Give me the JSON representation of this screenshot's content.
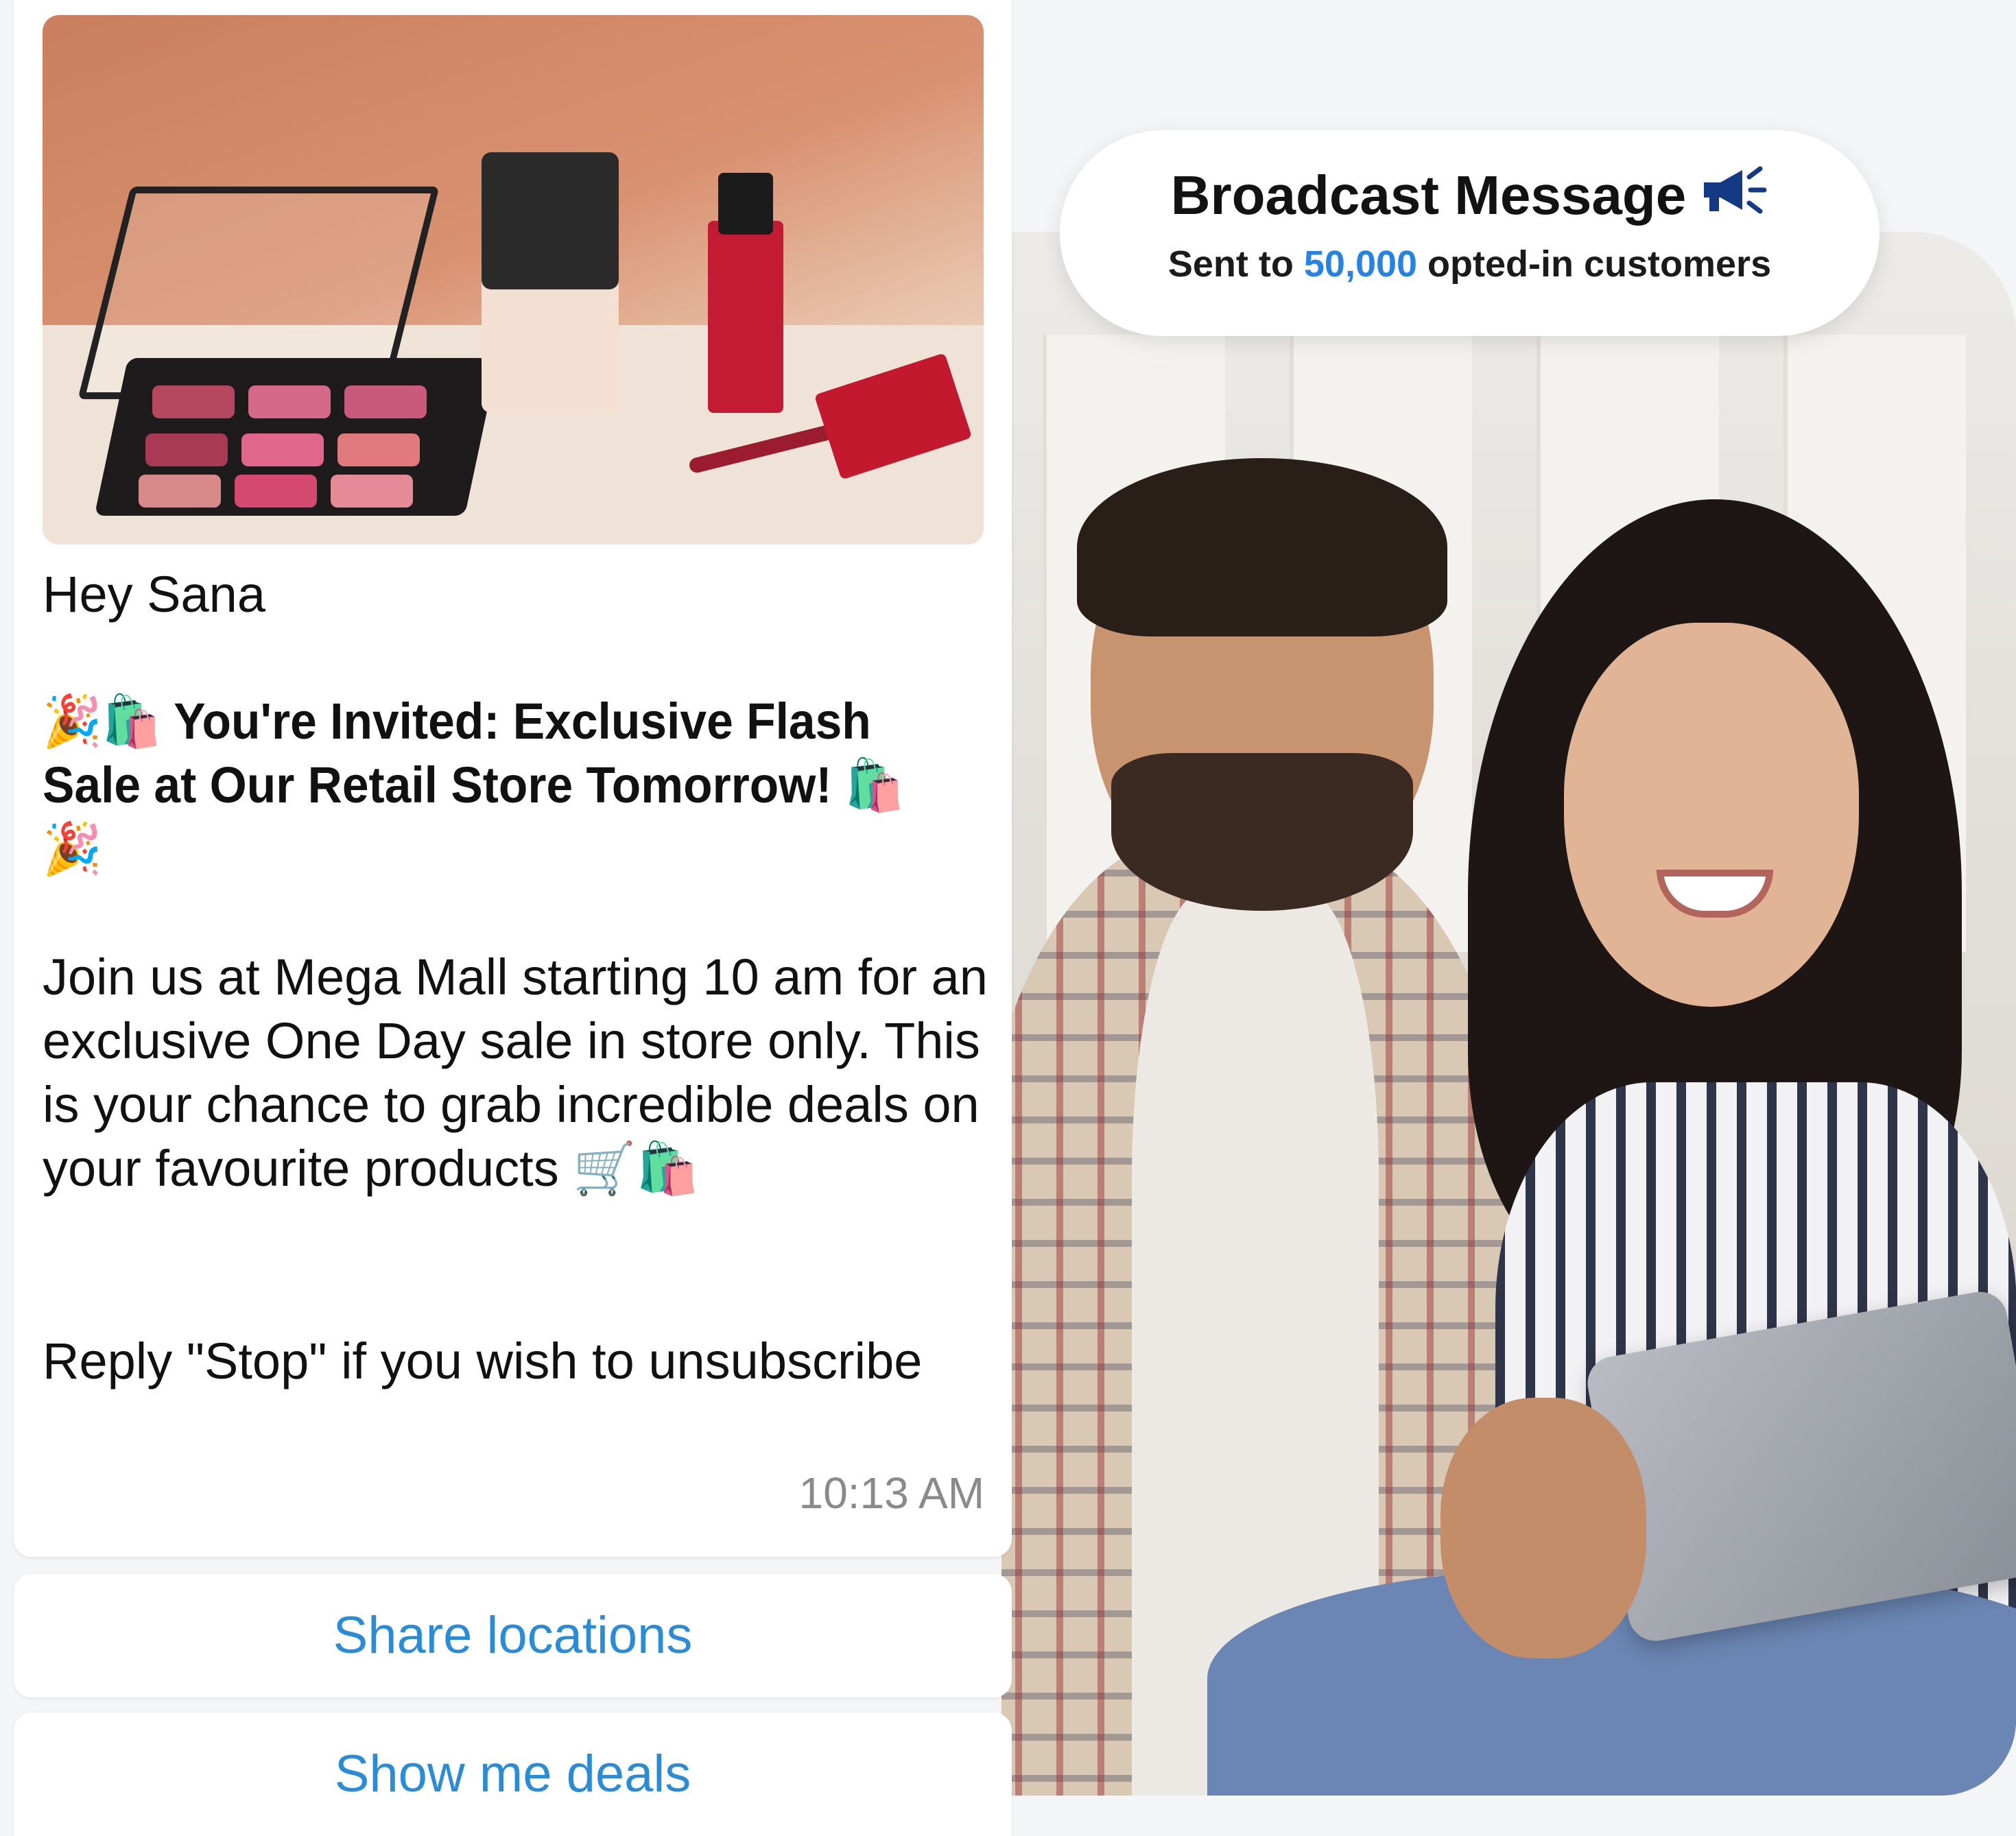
{
  "broadcast": {
    "title": "Broadcast Message",
    "icon": "megaphone-icon",
    "sub_prefix": "Sent to ",
    "count": "50,000",
    "sub_suffix": " opted-in customers",
    "accent_color": "#2583e3",
    "icon_color": "#143a86"
  },
  "message": {
    "greeting": "Hey Sana",
    "headline": "🎉🛍️ You're Invited: Exclusive Flash Sale at Our Retail Store Tomorrow! 🛍️🎉",
    "body": "Join us at Mega Mall starting 10 am for an exclusive One Day sale in store only.  This is your chance to grab incredible deals on your favourite products 🛒🛍️",
    "footer": "Reply \"Stop\" if you wish to unsubscribe",
    "time": "10:13 AM"
  },
  "quick_replies": [
    {
      "label": "Share locations"
    },
    {
      "label": "Show me deals"
    }
  ],
  "colors": {
    "link_blue": "#2a8bd6",
    "text_dark": "#111111",
    "timestamp_gray": "#8a8a8a"
  }
}
